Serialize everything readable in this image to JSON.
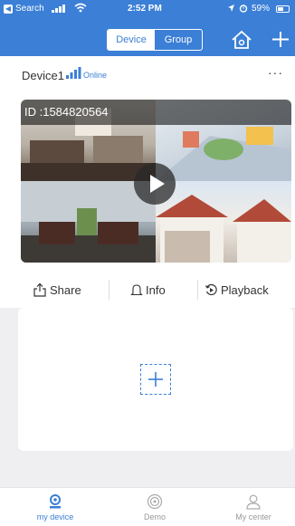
{
  "status_bar": {
    "back_app": "Search",
    "time": "2:52 PM",
    "battery": "59%",
    "battery_level": 0.59
  },
  "nav": {
    "segments": [
      "Device",
      "Group"
    ],
    "active_segment": "Device",
    "home_icon": "home-icon",
    "add_icon": "plus-icon"
  },
  "device": {
    "name": "Device1",
    "status": "Online",
    "more": "···"
  },
  "preview": {
    "id_label": "ID :1584820564",
    "play_icon": "play-icon"
  },
  "actions": [
    {
      "label": "Share",
      "icon": "share-icon"
    },
    {
      "label": "Info",
      "icon": "bell-icon"
    },
    {
      "label": "Playback",
      "icon": "replay-icon"
    }
  ],
  "tabs": [
    {
      "label": "my device",
      "icon": "camera-icon",
      "active": true
    },
    {
      "label": "Demo",
      "icon": "demo-icon",
      "active": false
    },
    {
      "label": "My center",
      "icon": "user-icon",
      "active": false
    }
  ],
  "colors": {
    "accent": "#3b7fd6",
    "background": "#efeff2"
  }
}
